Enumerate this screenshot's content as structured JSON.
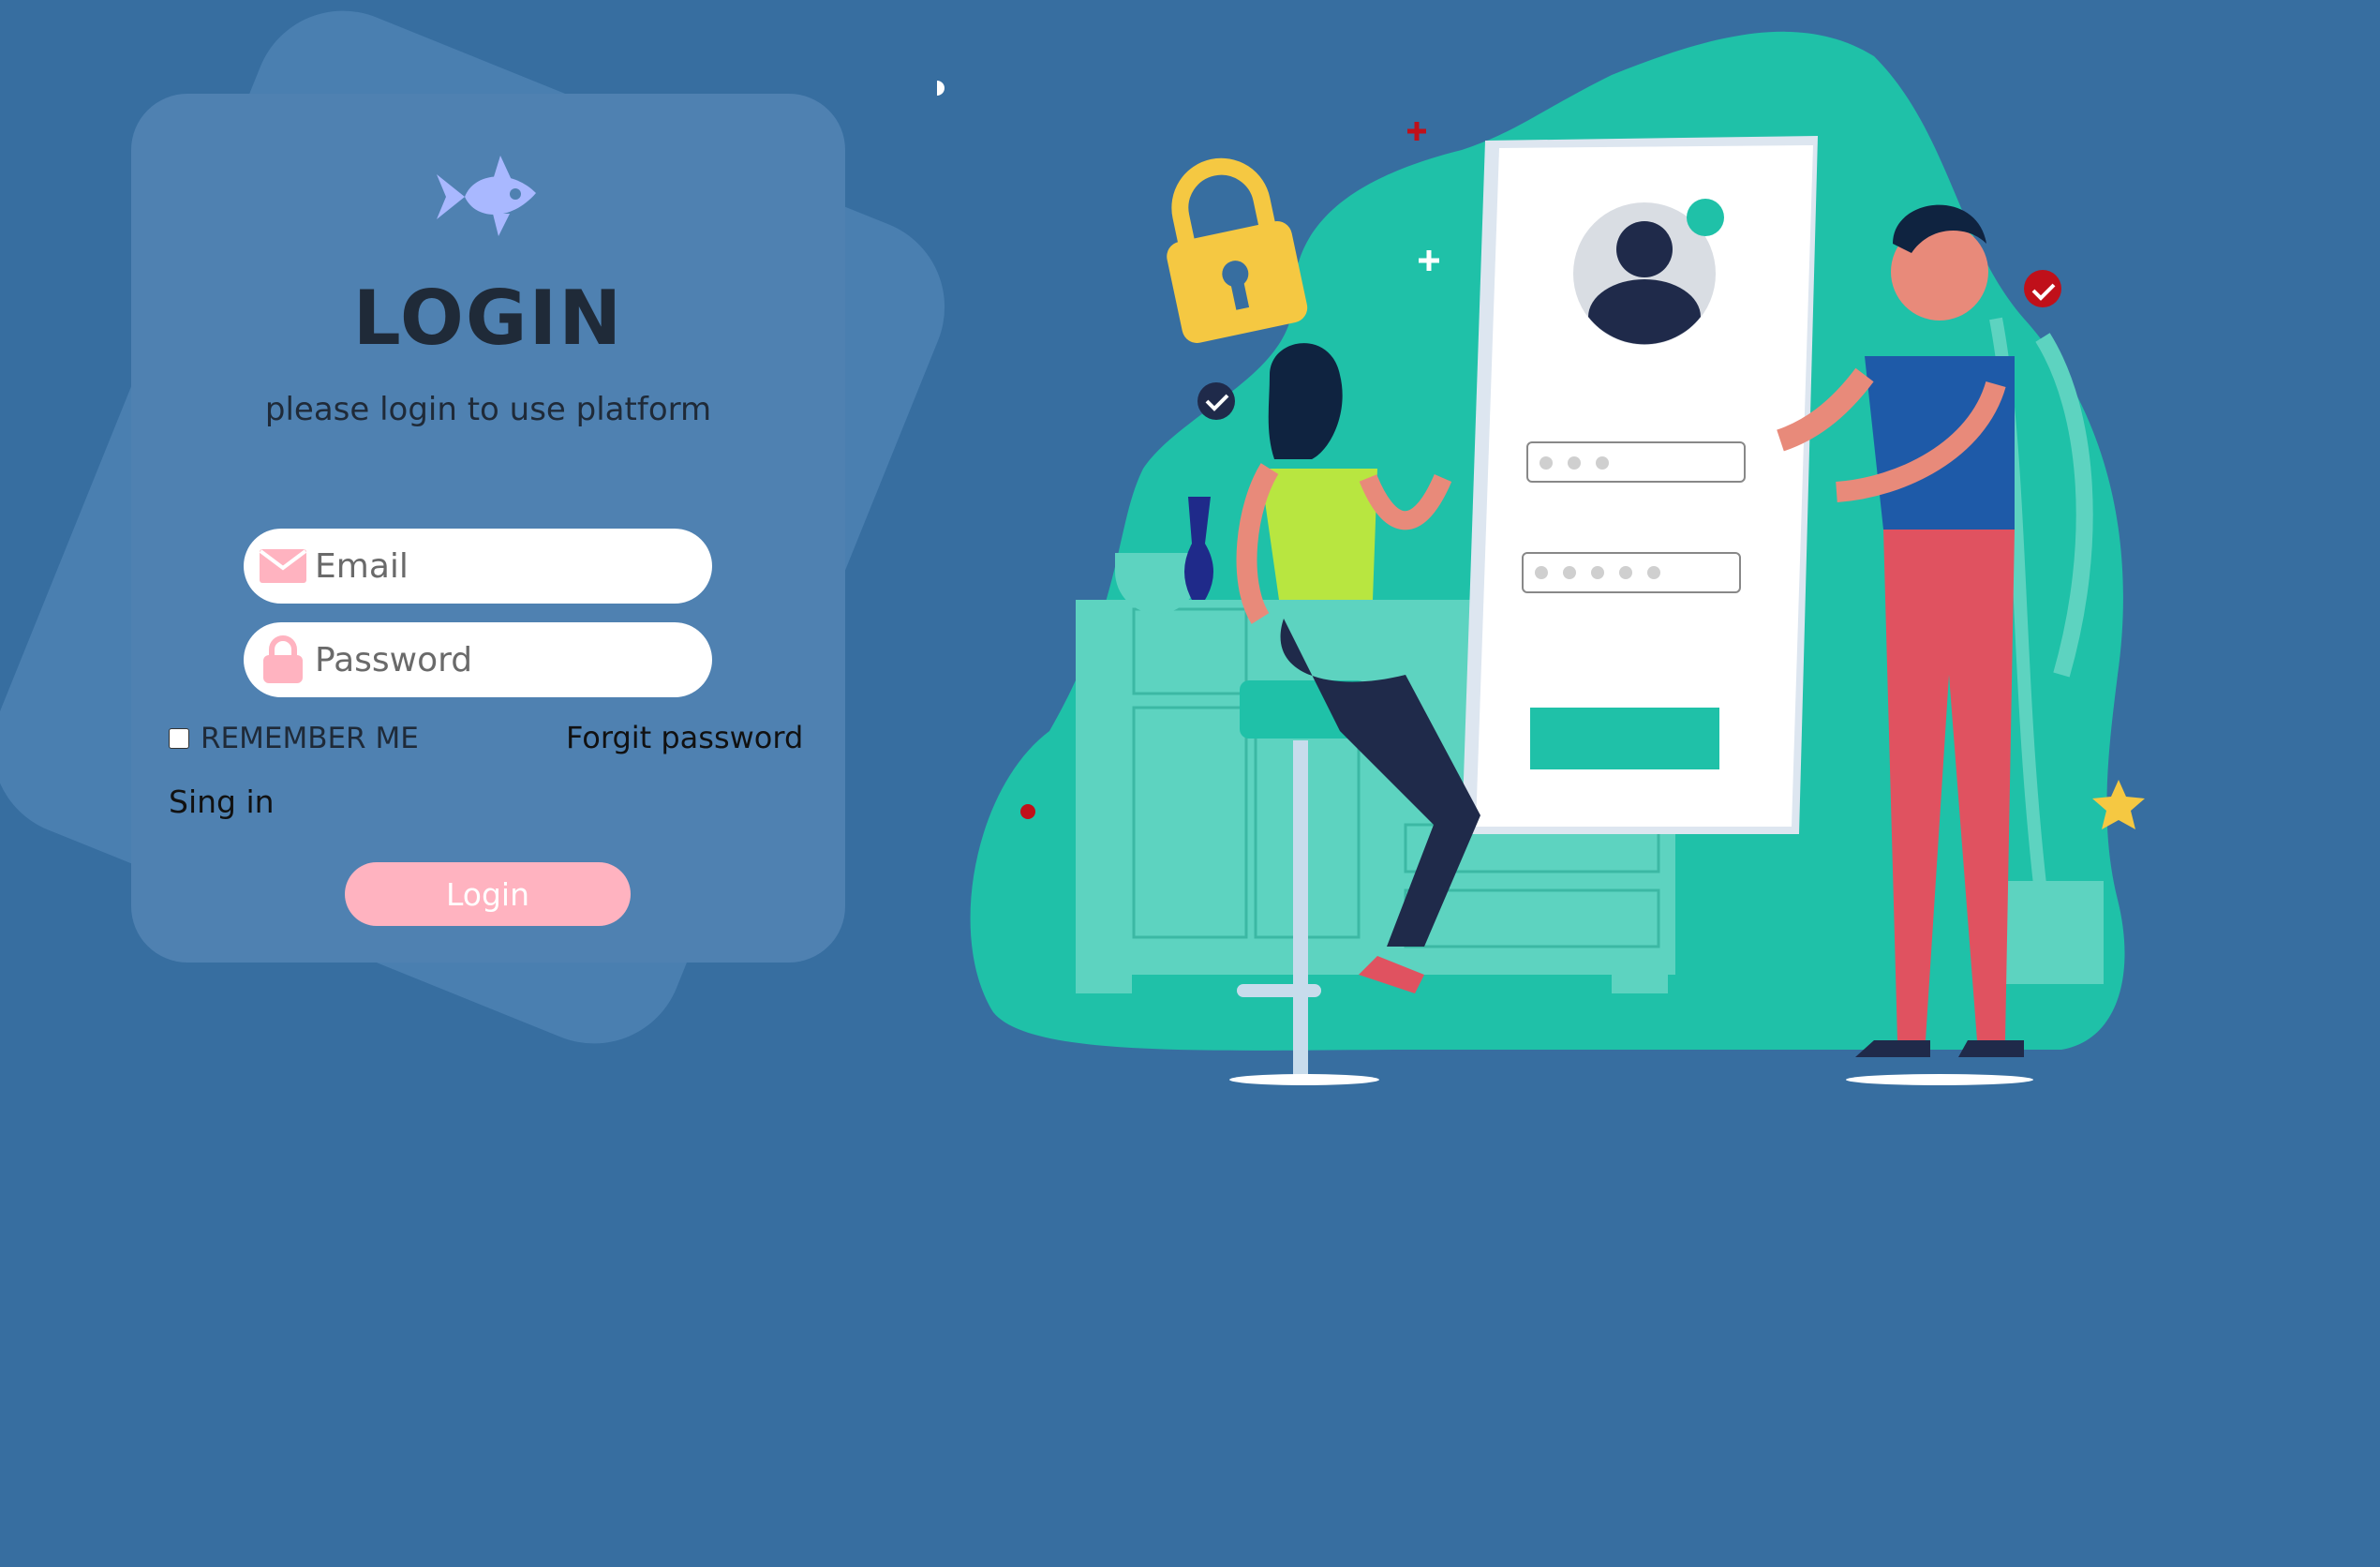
{
  "app": {
    "title": "LOGIN",
    "subtitle": "please login to use platform",
    "logo_icon": "fish-icon"
  },
  "form": {
    "email": {
      "placeholder": "Email",
      "value": "",
      "icon": "envelope-icon"
    },
    "password": {
      "placeholder": "Password",
      "value": "",
      "icon": "lock-icon"
    },
    "remember_label": "REMEMBER ME",
    "remember_checked": false,
    "forgot_label": "Forgit password",
    "signin_label": "Sing in",
    "submit_label": "Login"
  },
  "colors": {
    "background": "#376ea0",
    "card": "#4f81b1",
    "accent_pink": "#ffb3c0",
    "teal": "#1fc1a8",
    "title_text": "#1f2a38"
  }
}
